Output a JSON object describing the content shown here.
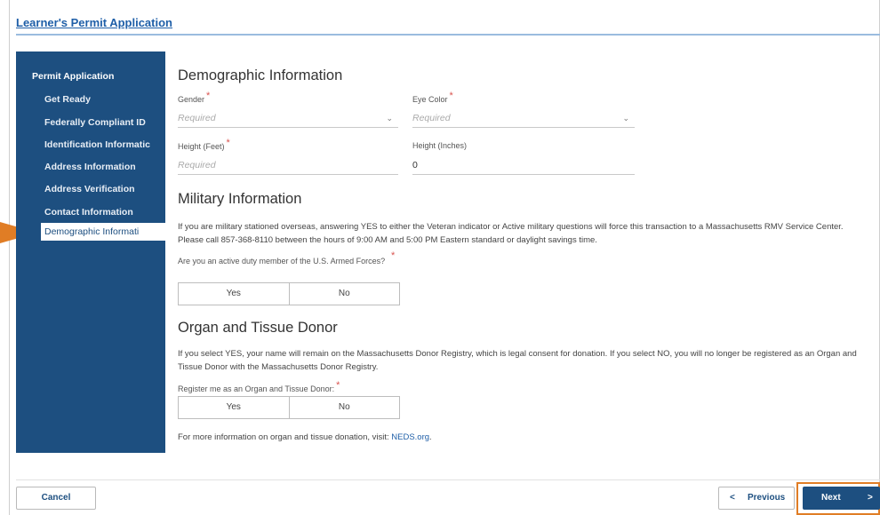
{
  "app": {
    "title": "Learner's Permit Application"
  },
  "sidebar": {
    "heading": "Permit Application",
    "items": [
      {
        "label": "Get Ready"
      },
      {
        "label": "Federally Compliant ID"
      },
      {
        "label": "Identification Informatic"
      },
      {
        "label": "Address Information"
      },
      {
        "label": "Address Verification"
      },
      {
        "label": "Contact Information"
      },
      {
        "label": "Demographic Informati"
      }
    ]
  },
  "demographic": {
    "title": "Demographic Information",
    "gender": {
      "label": "Gender",
      "placeholder": "Required"
    },
    "eye_color": {
      "label": "Eye Color",
      "placeholder": "Required"
    },
    "height_feet": {
      "label": "Height (Feet)",
      "placeholder": "Required"
    },
    "height_inches": {
      "label": "Height (Inches)",
      "value": "0"
    }
  },
  "military": {
    "title": "Military Information",
    "text": "If you are military stationed overseas, answering YES to either the Veteran indicator or Active military questions will force this transaction to a Massachusetts RMV Service Center. Please call 857-368-8110 between the hours of 9:00 AM and 5:00 PM Eastern standard or daylight savings time.",
    "question": "Are you an active duty member of the U.S. Armed Forces?",
    "yes": "Yes",
    "no": "No"
  },
  "donor": {
    "title": "Organ and Tissue Donor",
    "text": "If you select YES, your name will remain on the Massachusetts Donor Registry, which is legal consent for donation. If you select NO, you will no longer be registered as an Organ and Tissue Donor with the Massachusetts Donor Registry.",
    "question": "Register me as an Organ and Tissue Donor:",
    "yes": "Yes",
    "no": "No",
    "more_info": "For more information on organ and tissue donation, visit: ",
    "link": "NEDS.org",
    "link_suffix": "."
  },
  "footer": {
    "cancel": "Cancel",
    "previous": "Previous",
    "next": "Next",
    "prev_arrow": "<",
    "next_arrow": ">"
  },
  "colors": {
    "sidebar_bg": "#1d4f80",
    "accent_orange": "#e07d25",
    "link_blue": "#1f5fa8",
    "required_red": "#d9534f"
  },
  "icons": {
    "select_chevron": "⌄"
  }
}
